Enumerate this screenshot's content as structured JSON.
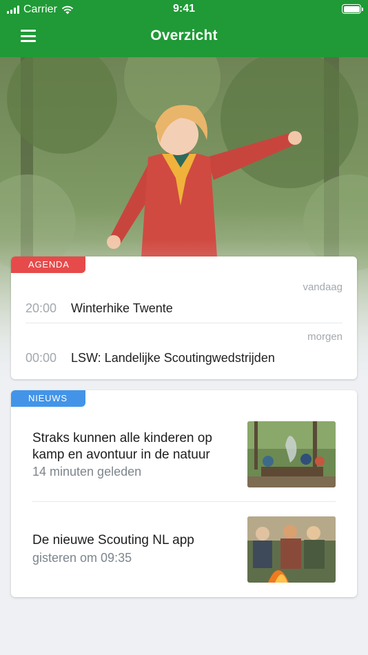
{
  "status_bar": {
    "carrier": "Carrier",
    "time": "9:41"
  },
  "header": {
    "title": "Overzicht",
    "menu_icon": "hamburger-icon"
  },
  "colors": {
    "brand_green": "#1f9a36",
    "agenda_red": "#e74a4a",
    "news_blue": "#4394e8"
  },
  "agenda": {
    "tag": "AGENDA",
    "groups": [
      {
        "day": "vandaag",
        "time": "20:00",
        "name": "Winterhike Twente"
      },
      {
        "day": "morgen",
        "time": "00:00",
        "name": "LSW: Landelijke Scoutingwedstrijden"
      }
    ]
  },
  "news": {
    "tag": "NIEUWS",
    "items": [
      {
        "title": "Straks kunnen alle kinderen op kamp en avontuur in de natuur",
        "meta": "14 minuten geleden"
      },
      {
        "title": "De nieuwe Scouting NL app",
        "meta": "gisteren om 09:35"
      }
    ]
  }
}
